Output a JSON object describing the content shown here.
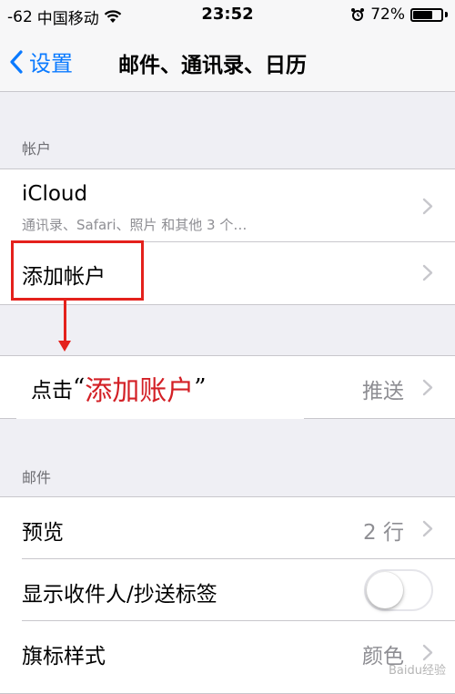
{
  "status_bar": {
    "signal": "-62",
    "carrier": "中国移动",
    "time": "23:52",
    "battery_percent": "72%",
    "battery_level": 0.72
  },
  "nav": {
    "back_label": "设置",
    "title": "邮件、通讯录、日历"
  },
  "accounts_section": {
    "header": "帐户",
    "items": [
      {
        "label": "iCloud",
        "subtitle": "通讯录、Safari、照片 和其他 3 个…"
      },
      {
        "label": "添加帐户"
      }
    ]
  },
  "fetch_row": {
    "value": "推送"
  },
  "annotation": {
    "prefix": "点击",
    "open_quote": "“",
    "emphasis": "添加账户",
    "close_quote": "”"
  },
  "mail_section": {
    "header": "邮件",
    "items": [
      {
        "label": "预览",
        "value": "2 行"
      },
      {
        "label": "显示收件人/抄送标签",
        "toggle": false
      },
      {
        "label": "旗标样式",
        "value": "颜色"
      }
    ]
  },
  "watermark": "Baidu经验",
  "colors": {
    "accent": "#0a7aff",
    "annotation_red": "#e4211c",
    "background": "#efeff4"
  }
}
